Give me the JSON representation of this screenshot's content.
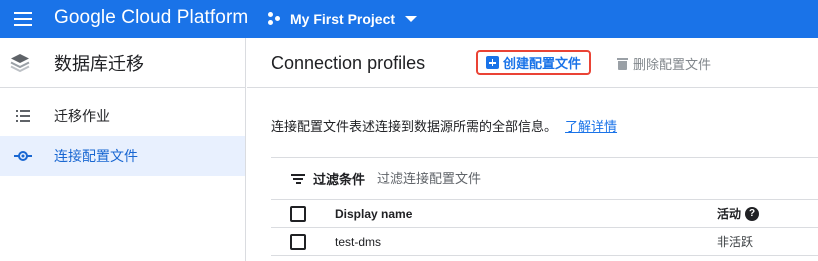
{
  "topbar": {
    "menu_icon": "hamburger-menu-icon",
    "title": "Google Cloud Platform",
    "project_icon": "project-hub-icon",
    "project_name": "My First Project",
    "dropdown_icon": "caret-down-icon"
  },
  "sidebar": {
    "logo_icon": "database-migration-logo-icon",
    "title": "数据库迁移",
    "items": [
      {
        "label": "迁移作业",
        "icon": "list-icon",
        "active": false
      },
      {
        "label": "连接配置文件",
        "icon": "connection-profile-icon",
        "active": true
      }
    ]
  },
  "main": {
    "title": "Connection profiles",
    "create_label": "创建配置文件",
    "create_icon": "add-box-icon",
    "delete_label": "删除配置文件",
    "delete_icon": "trash-icon",
    "description": "连接配置文件表述连接到数据源所需的全部信息。",
    "learn_more": "了解详情",
    "filter": {
      "icon": "filter-icon",
      "label": "过滤条件",
      "placeholder": "过滤连接配置文件"
    },
    "table": {
      "columns": {
        "name": "Display name",
        "status": "活动"
      },
      "help_icon": "help-icon",
      "rows": [
        {
          "name": "test-dms",
          "status": "非活跃"
        }
      ]
    }
  },
  "colors": {
    "accent": "#1a73e8",
    "highlight_border": "#ea4335",
    "active_bg": "#e8f0fe"
  }
}
